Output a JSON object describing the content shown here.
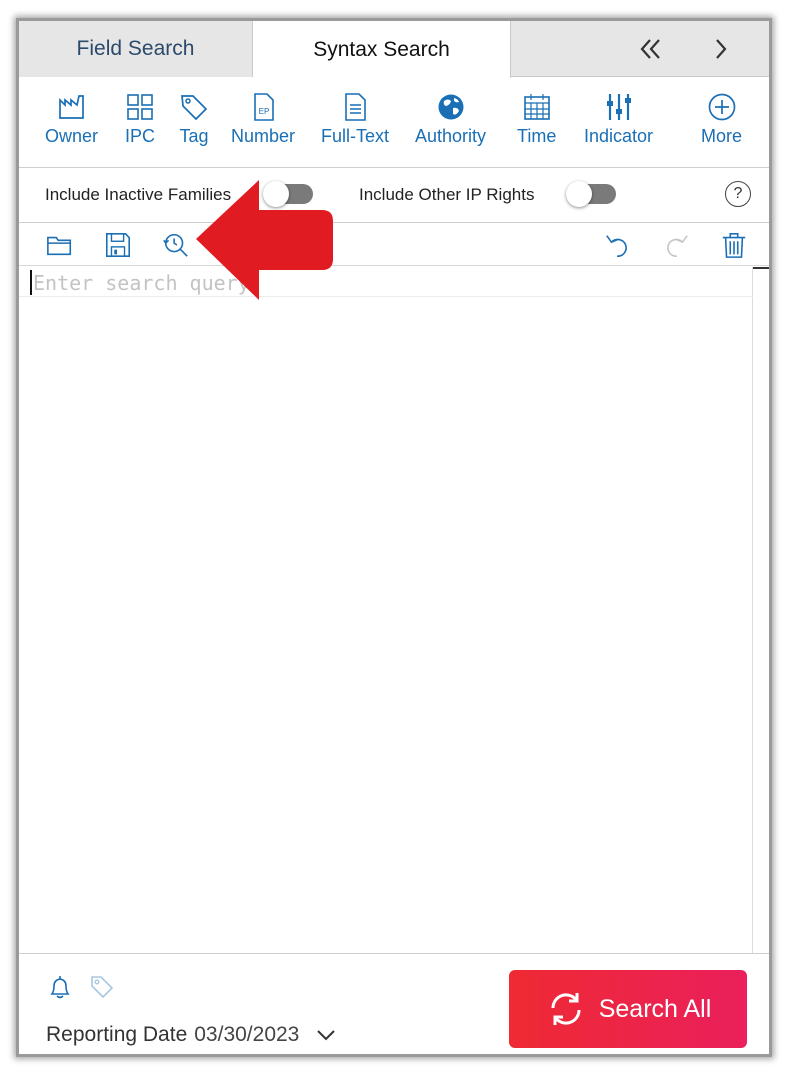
{
  "tabs": {
    "field_search": "Field Search",
    "syntax_search": "Syntax Search",
    "nav_prev_icon": "double-chevron-left-icon",
    "nav_next_icon": "chevron-right-icon"
  },
  "toolbar": {
    "items": [
      {
        "label": "Owner",
        "icon": "factory-icon"
      },
      {
        "label": "IPC",
        "icon": "grid-icon"
      },
      {
        "label": "Tag",
        "icon": "tag-icon"
      },
      {
        "label": "Number",
        "icon": "ep-document-icon"
      },
      {
        "label": "Full-Text",
        "icon": "text-document-icon"
      },
      {
        "label": "Authority",
        "icon": "globe-icon"
      },
      {
        "label": "Time",
        "icon": "calendar-icon"
      },
      {
        "label": "Indicator",
        "icon": "sliders-icon"
      },
      {
        "label": "More",
        "icon": "plus-circle-icon"
      }
    ]
  },
  "toggles": {
    "inactive_families": {
      "label": "Include Inactive Families",
      "on": false
    },
    "other_ip_rights": {
      "label": "Include Other IP Rights",
      "on": false
    },
    "help_label": "?"
  },
  "editor": {
    "placeholder": "Enter search query",
    "value": ""
  },
  "footer": {
    "reporting_label": "Reporting Date",
    "reporting_date": "03/30/2023",
    "search_button": "Search All"
  },
  "colors": {
    "accent": "#1a6fb5",
    "search_button_start": "#ef2a33",
    "search_button_end": "#ea1f5c",
    "annotation_arrow": "#e11b22"
  }
}
